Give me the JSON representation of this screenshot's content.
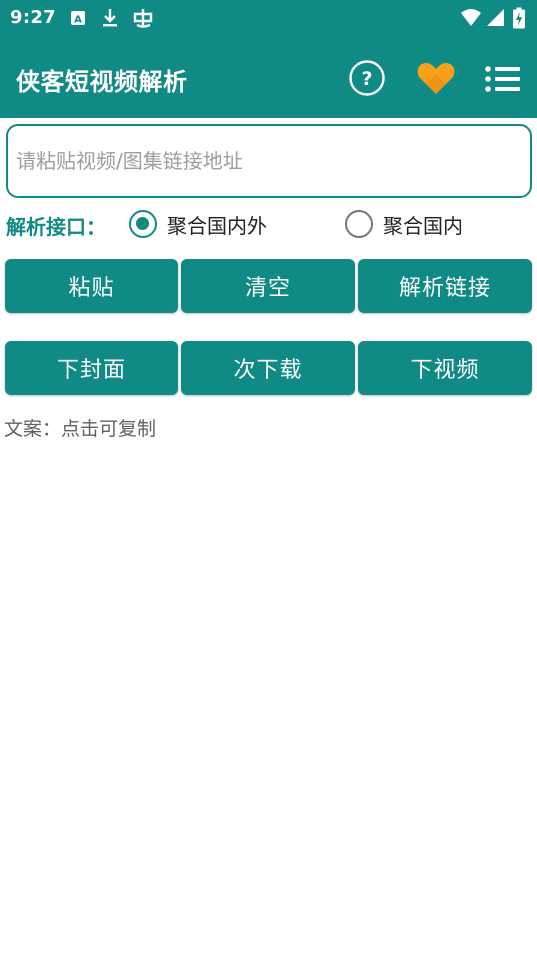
{
  "status_bar": {
    "time": "9:27",
    "left_icons": [
      "a-notification-icon",
      "download-icon",
      "bug-icon"
    ],
    "right_icons": [
      "wifi-icon",
      "signal-icon",
      "battery-charging-icon"
    ]
  },
  "app_bar": {
    "title": "侠客短视频解析",
    "actions": [
      "help-icon",
      "heart-icon",
      "menu-list-icon"
    ],
    "heart_color": "#f7a11a"
  },
  "link_input": {
    "value": "",
    "placeholder": "请粘贴视频/图集链接地址"
  },
  "api_selector": {
    "label": "解析接口：",
    "options": [
      {
        "label": "聚合国内外",
        "selected": true
      },
      {
        "label": "聚合国内",
        "selected": false
      }
    ]
  },
  "row1": {
    "paste": "粘贴",
    "clear": "清空",
    "parse": "解析链接"
  },
  "row2": {
    "cover": "下封面",
    "times": "次下载",
    "video": "下视频"
  },
  "copy_text": "文案：点击可复制",
  "colors": {
    "primary": "#0f8a84",
    "accent": "#f7a11a"
  }
}
